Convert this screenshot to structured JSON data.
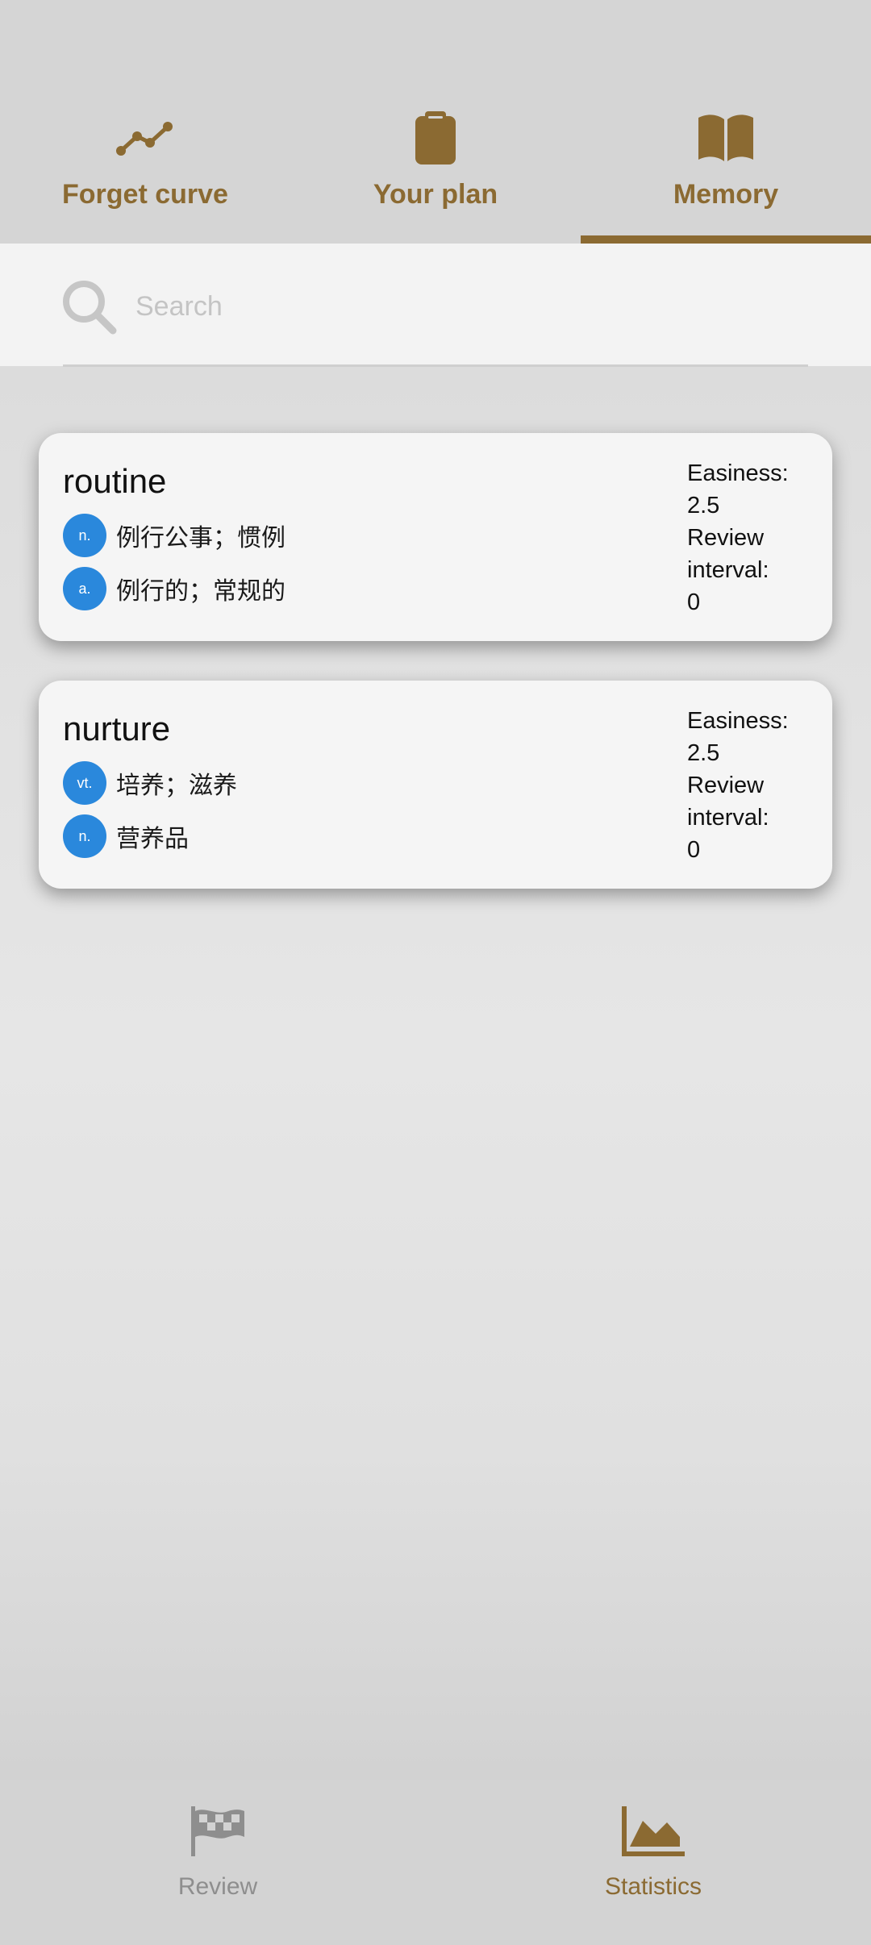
{
  "tabs": [
    {
      "label": "Forget curve",
      "icon": "line-chart-icon",
      "active": false
    },
    {
      "label": "Your plan",
      "icon": "clipboard-icon",
      "active": false
    },
    {
      "label": "Memory",
      "icon": "book-icon",
      "active": true
    }
  ],
  "search": {
    "placeholder": "Search",
    "value": ""
  },
  "cards": [
    {
      "word": "routine",
      "definitions": [
        {
          "pos": "n.",
          "text": "例行公事；惯例"
        },
        {
          "pos": "a.",
          "text": "例行的；常规的"
        }
      ],
      "easiness_label": "Easiness:",
      "easiness_value": "2.5",
      "interval_label_1": "Review",
      "interval_label_2": "interval:",
      "interval_value": "0"
    },
    {
      "word": "nurture",
      "definitions": [
        {
          "pos": "vt.",
          "text": "培养；滋养"
        },
        {
          "pos": "n.",
          "text": "营养品"
        }
      ],
      "easiness_label": "Easiness:",
      "easiness_value": "2.5",
      "interval_label_1": "Review",
      "interval_label_2": "interval:",
      "interval_value": "0"
    }
  ],
  "bottom_nav": [
    {
      "label": "Review",
      "icon": "checkered-flag-icon",
      "active": false
    },
    {
      "label": "Statistics",
      "icon": "area-chart-icon",
      "active": true
    }
  ],
  "colors": {
    "accent": "#8b6a32",
    "badge": "#2a88dc",
    "inactive": "#8e8e8e"
  }
}
